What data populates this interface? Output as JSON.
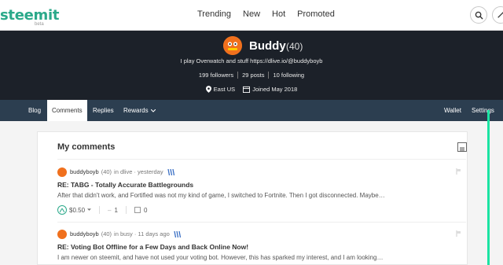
{
  "header": {
    "logo": "steemit",
    "logo_sub": "beta",
    "nav": [
      "Trending",
      "New",
      "Hot",
      "Promoted"
    ]
  },
  "profile": {
    "name": "Buddy",
    "reputation": "(40)",
    "about": "I play Overwatch and stuff https://dlive.io/@buddyboyb",
    "followers": "199 followers",
    "posts": "29 posts",
    "following": "10 following",
    "location": "East US",
    "joined": "Joined May 2018"
  },
  "tabs": {
    "blog": "Blog",
    "comments": "Comments",
    "replies": "Replies",
    "rewards": "Rewards",
    "wallet": "Wallet",
    "settings": "Settings"
  },
  "main": {
    "title": "My comments",
    "posts": [
      {
        "author": "buddyboyb",
        "rep": "(40)",
        "meta": "in dlive · yesterday",
        "title": "RE: TABG - Totally Accurate Battlegrounds",
        "body": "After that didn't work, and Fortified was not my kind of game, I switched to Fortnite. Then I got disconnected. Maybe…",
        "payout": "$0.50",
        "votes": "1",
        "replies": "0"
      },
      {
        "author": "buddyboyb",
        "rep": "(40)",
        "meta": "in busy · 11 days ago",
        "title": "RE: Voting Bot Offline for a Few Days and Back Online Now!",
        "body": "I am newer on steemit, and have not used your voting bot. However, this has sparked my interest, and I am looking…"
      }
    ]
  },
  "colors": {
    "brand": "#2ba98a",
    "banner": "#1c2129",
    "tabbar": "#2c3e50",
    "accent": "#1ce3a3"
  },
  "icons": [
    "search-icon",
    "pencil-icon",
    "location-pin-icon",
    "calendar-icon",
    "list-view-icon",
    "upvote-icon",
    "chevron-down-icon",
    "comment-icon",
    "flag-icon",
    "steem-power-icon"
  ]
}
